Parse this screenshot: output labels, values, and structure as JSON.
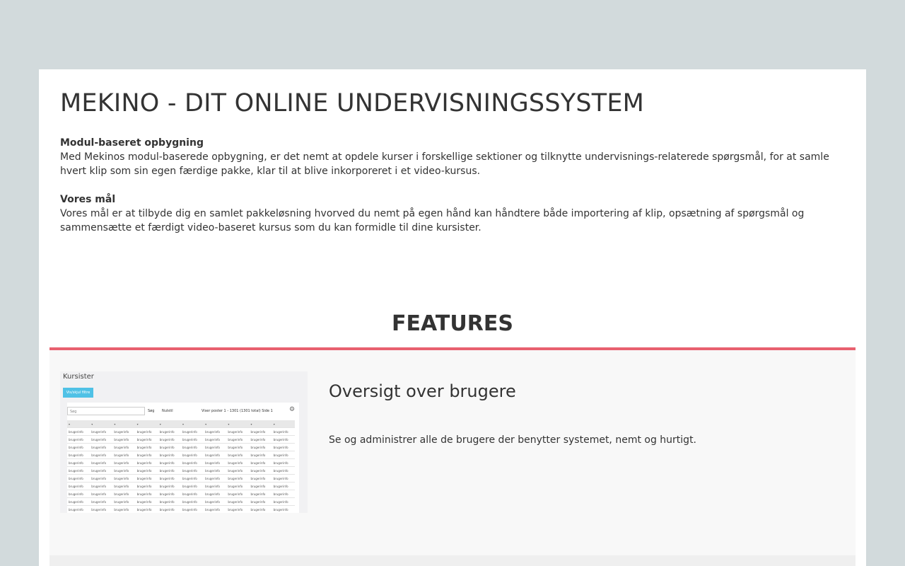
{
  "page": {
    "title": "MEKINO - DIT ONLINE UNDERVISNINGSSYSTEM",
    "sections": [
      {
        "heading": "Modul-baseret opbygning",
        "body": "Med Mekinos modul-baserede opbygning, er det nemt at opdele kurser i forskellige sektioner og tilknytte undervisnings-relaterede spørgsmål, for at samle hvert klip som sin egen færdige pakke, klar til at blive inkorporeret i et video-kursus."
      },
      {
        "heading": "Vores mål",
        "body": "Vores mål er at tilbyde dig en samlet pakkeløsning hvorved du nemt på egen hånd kan håndtere både importering af klip, opsætning af spørgsmål og sammensætte et færdigt video-baseret kursus som du kan formidle til dine kursister."
      }
    ]
  },
  "features": {
    "title": "FEATURES",
    "items": [
      {
        "heading": "Oversigt over brugere",
        "description": "Se og administrer alle de brugere der benytter systemet, nemt og hurtigt.",
        "thumbnail": {
          "title": "Kursister",
          "button": "Vis/skjul filtre",
          "search_placeholder": "Søg",
          "search_button": "Søg",
          "reset_button": "Nulstil",
          "paging": "Viser poster 1 - 1301 (1301 total)  Side 1",
          "cell": "brugerinfo"
        }
      }
    ]
  },
  "colors": {
    "background": "#d2dadc",
    "accent": "#e8606f",
    "card": "#ffffff",
    "panel": "#f8f8f8"
  }
}
